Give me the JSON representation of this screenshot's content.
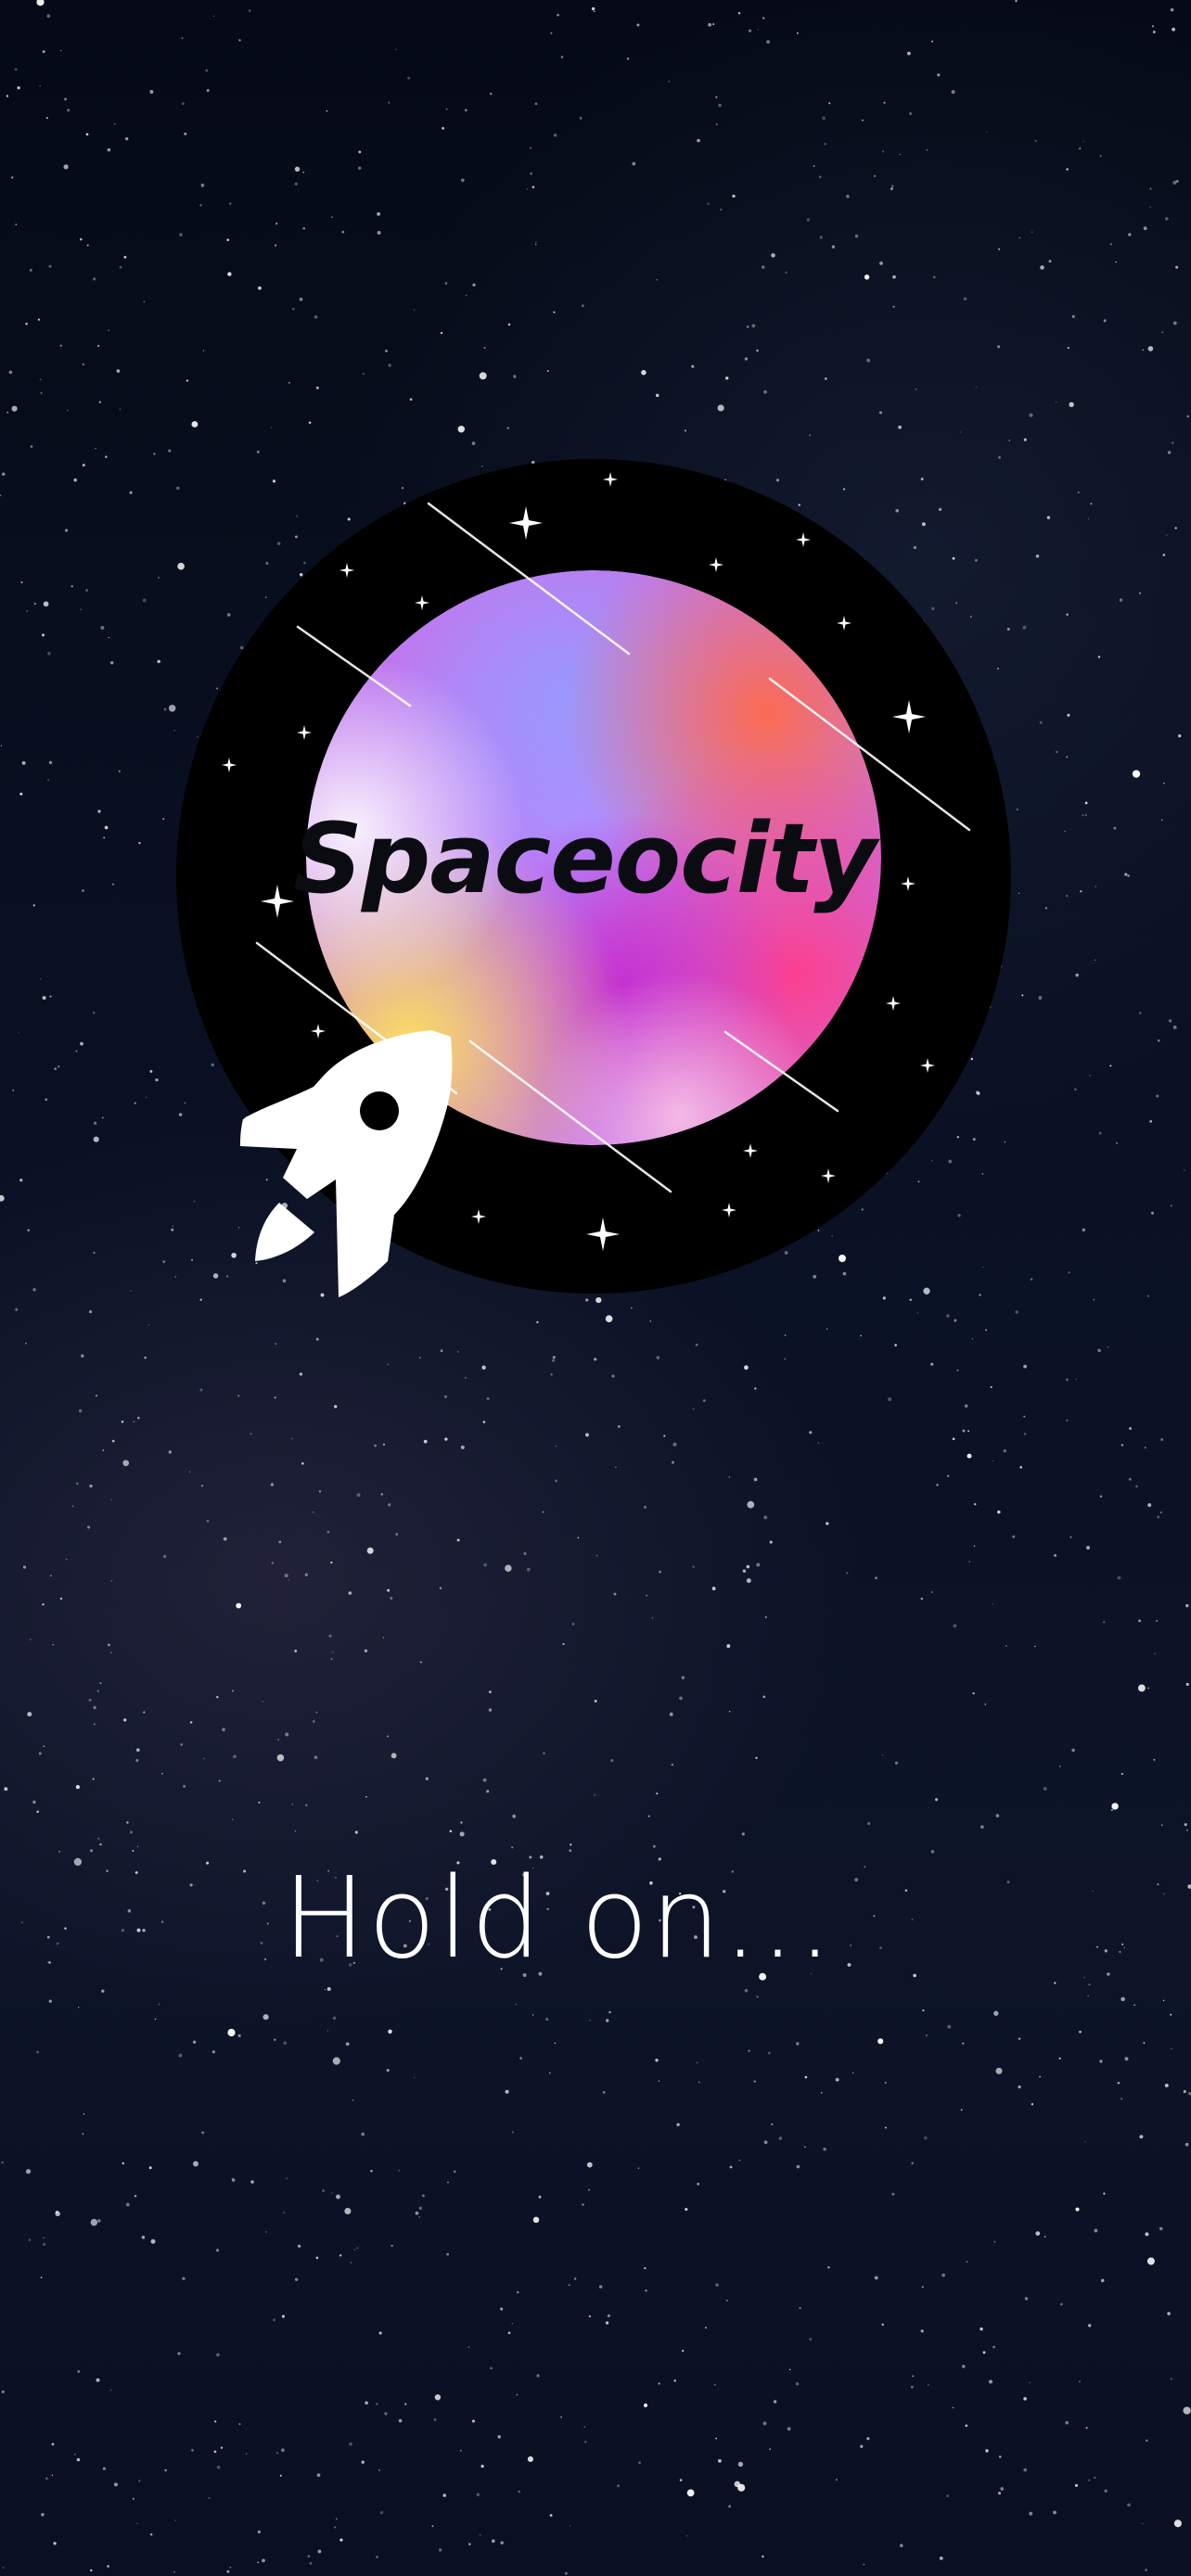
{
  "splash": {
    "brand_name": "Spaceocity",
    "loading_text": "Hold on..."
  },
  "logo": {
    "icon": "rocket-icon",
    "colors": {
      "ring": "#000000",
      "planet_violet": "#a98bff",
      "planet_pink": "#f0469a",
      "planet_orange": "#ff7a50",
      "planet_yellow": "#ffd45a",
      "text": "#0b0b12"
    }
  },
  "background": {
    "color": "#0a1022",
    "star_color": "#ffffff"
  }
}
